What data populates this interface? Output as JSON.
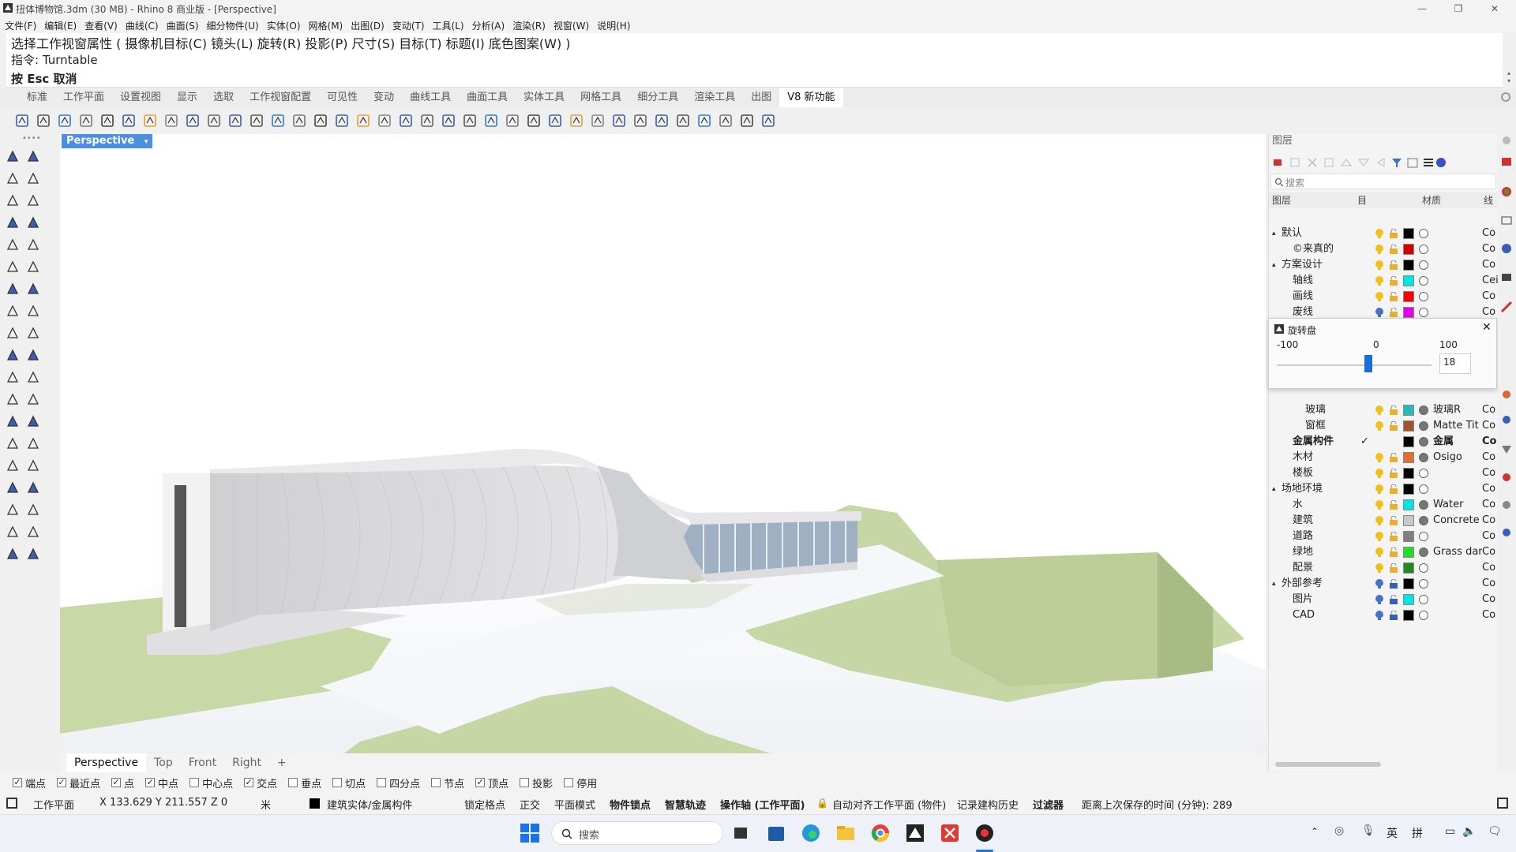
{
  "window": {
    "title": "扭体博物馆.3dm (30 MB) - Rhino 8 商业版 - [Perspective]"
  },
  "menu": [
    "文件(F)",
    "编辑(E)",
    "查看(V)",
    "曲线(C)",
    "曲面(S)",
    "细分物件(U)",
    "实体(O)",
    "网格(M)",
    "出图(D)",
    "变动(T)",
    "工具(L)",
    "分析(A)",
    "渲染(R)",
    "视窗(W)",
    "说明(H)"
  ],
  "command": {
    "line1": "选择工作视窗属性 ( 摄像机目标(C)  镜头(L)  旋转(R)  投影(P)  尺寸(S)  目标(T)  标题(I)  底色图案(W) )",
    "line2": "指令: Turntable",
    "line3": "按 Esc 取消"
  },
  "tabs": [
    "标准",
    "工作平面",
    "设置视图",
    "显示",
    "选取",
    "工作视窗配置",
    "可见性",
    "变动",
    "曲线工具",
    "曲面工具",
    "实体工具",
    "网格工具",
    "细分工具",
    "渲染工具",
    "出图",
    "V8 新功能"
  ],
  "active_tab": "V8 新功能",
  "viewport": {
    "label": "Perspective",
    "tabs": [
      "Perspective",
      "Top",
      "Front",
      "Right"
    ],
    "add_tab": "+"
  },
  "layers_panel": {
    "title": "图层",
    "search_placeholder": "搜索",
    "columns": {
      "name": "图层",
      "target": "目",
      "material": "材质",
      "linetype": "线"
    },
    "rows": [
      {
        "name": "默认",
        "indent": 0,
        "expand": "▴",
        "color": "#000000",
        "material": "",
        "linetype": "Co"
      },
      {
        "name": "©来真的",
        "indent": 1,
        "color": "#d40000",
        "material": "",
        "linetype": "Co"
      },
      {
        "name": "方案设计",
        "indent": 0,
        "expand": "▴",
        "color": "#000000",
        "material": "",
        "linetype": "Co"
      },
      {
        "name": "轴线",
        "indent": 1,
        "color": "#00e6e6",
        "material": "",
        "linetype": "Cei"
      },
      {
        "name": "画线",
        "indent": 1,
        "color": "#ff0000",
        "material": "",
        "linetype": "Co"
      },
      {
        "name": "废线",
        "indent": 1,
        "color": "#e600e6",
        "material": "",
        "linetype": "Co"
      },
      {
        "name": "玻璃",
        "indent": 2,
        "color": "#2ab8b8",
        "material": "玻璃R",
        "linetype": "Co"
      },
      {
        "name": "窗框",
        "indent": 2,
        "color": "#a0522d",
        "material": "Matte Tit",
        "linetype": "Co"
      },
      {
        "name": "金属构件",
        "indent": 1,
        "color": "#000000",
        "material": "金属",
        "linetype": "Co",
        "current": true
      },
      {
        "name": "木材",
        "indent": 1,
        "color": "#e07030",
        "material": "Osigo",
        "linetype": "Co"
      },
      {
        "name": "楼板",
        "indent": 1,
        "color": "#000000",
        "material": "",
        "linetype": "Co"
      },
      {
        "name": "场地环境",
        "indent": 0,
        "expand": "▴",
        "color": "#000000",
        "material": "",
        "linetype": "Co"
      },
      {
        "name": "水",
        "indent": 1,
        "color": "#00e6e6",
        "material": "Water",
        "linetype": "Co"
      },
      {
        "name": "建筑",
        "indent": 1,
        "color": "#c8c8c8",
        "material": "Concrete",
        "linetype": "Co"
      },
      {
        "name": "道路",
        "indent": 1,
        "color": "#808080",
        "material": "",
        "linetype": "Co"
      },
      {
        "name": "绿地",
        "indent": 1,
        "color": "#22dd22",
        "material": "Grass dark",
        "linetype": "Co"
      },
      {
        "name": "配景",
        "indent": 1,
        "color": "#228822",
        "material": "",
        "linetype": "Co"
      },
      {
        "name": "外部参考",
        "indent": 0,
        "expand": "▴",
        "color": "#000000",
        "material": "",
        "linetype": "Co"
      },
      {
        "name": "图片",
        "indent": 1,
        "color": "#00e6e6",
        "material": "",
        "linetype": "Co"
      },
      {
        "name": "CAD",
        "indent": 1,
        "color": "#000000",
        "material": "",
        "linetype": "Co"
      }
    ]
  },
  "turntable_popup": {
    "title": "旋转盘",
    "min_label": "-100",
    "mid_label": "0",
    "max_label": "100",
    "value": "18"
  },
  "osnap": [
    {
      "label": "端点",
      "checked": true
    },
    {
      "label": "最近点",
      "checked": true
    },
    {
      "label": "点",
      "checked": true
    },
    {
      "label": "中点",
      "checked": true
    },
    {
      "label": "中心点",
      "checked": false
    },
    {
      "label": "交点",
      "checked": true
    },
    {
      "label": "垂点",
      "checked": false
    },
    {
      "label": "切点",
      "checked": false
    },
    {
      "label": "四分点",
      "checked": false
    },
    {
      "label": "节点",
      "checked": false
    },
    {
      "label": "顶点",
      "checked": true
    },
    {
      "label": "投影",
      "checked": false
    },
    {
      "label": "停用",
      "checked": false
    }
  ],
  "status": {
    "cplane": "工作平面",
    "coords": "X 133.629 Y 211.557 Z 0",
    "unit": "米",
    "layer": "建筑实体/金属构件",
    "grid_snap": "锁定格点",
    "ortho": "正交",
    "planar": "平面模式",
    "osnap": "物件锁点",
    "smarttrack": "智慧轨迹",
    "gumball": "操作轴 (工作平面)",
    "autocplane": "自动对齐工作平面 (物件)",
    "history": "记录建构历史",
    "filter": "过滤器",
    "autosave": "距离上次保存的时间 (分钟): 289"
  },
  "taskbar": {
    "search_placeholder": "搜索",
    "ime1": "英",
    "ime2": "拼"
  },
  "colors": {
    "accent": "#4a8fe0",
    "building": "#d9d9db",
    "grass": "#c6d6a4"
  }
}
